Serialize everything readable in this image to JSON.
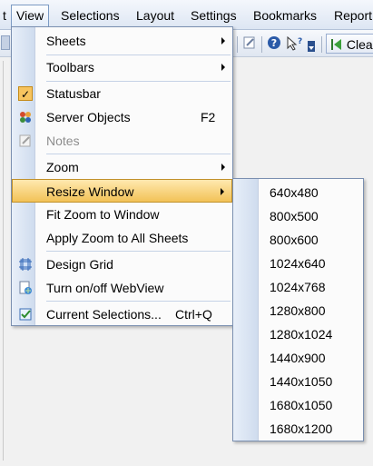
{
  "menubar": {
    "items": [
      {
        "label": "t"
      },
      {
        "label": "View"
      },
      {
        "label": "Selections"
      },
      {
        "label": "Layout"
      },
      {
        "label": "Settings"
      },
      {
        "label": "Bookmarks"
      },
      {
        "label": "Report"
      }
    ]
  },
  "toolbar": {
    "clear_label": "Clear"
  },
  "view_menu": {
    "items": [
      {
        "label": "Sheets",
        "submenu": true
      },
      {
        "label": "Toolbars",
        "submenu": true
      },
      {
        "label": "Statusbar",
        "checked": true
      },
      {
        "label": "Server Objects",
        "accel": "F2",
        "icon": "server-objects-icon"
      },
      {
        "label": "Notes",
        "disabled": true,
        "icon": "notes-icon"
      },
      {
        "label": "Zoom",
        "submenu": true
      },
      {
        "label": "Resize Window",
        "submenu": true,
        "highlighted": true
      },
      {
        "label": "Fit Zoom to Window"
      },
      {
        "label": "Apply Zoom to All Sheets"
      },
      {
        "label": "Design Grid",
        "icon": "design-grid-icon"
      },
      {
        "label": "Turn on/off WebView",
        "icon": "webview-icon"
      },
      {
        "label": "Current Selections...",
        "accel": "Ctrl+Q",
        "icon": "current-selections-icon"
      }
    ]
  },
  "resize_submenu": {
    "items": [
      {
        "label": "640x480"
      },
      {
        "label": "800x500"
      },
      {
        "label": "800x600"
      },
      {
        "label": "1024x640"
      },
      {
        "label": "1024x768"
      },
      {
        "label": "1280x800"
      },
      {
        "label": "1280x1024"
      },
      {
        "label": "1440x900"
      },
      {
        "label": "1440x1050"
      },
      {
        "label": "1680x1050"
      },
      {
        "label": "1680x1200"
      }
    ]
  },
  "colors": {
    "highlight": "#f2c257",
    "menu_border": "#7a8fb0",
    "gutter": "#cfdcee"
  }
}
